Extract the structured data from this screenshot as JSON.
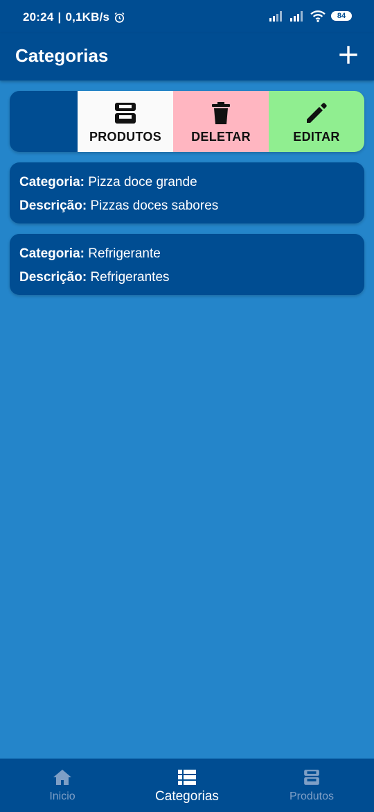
{
  "status": {
    "time": "20:24",
    "network_speed": "0,1KB/s",
    "battery": "84"
  },
  "appbar": {
    "title": "Categorias",
    "add_icon": "plus-icon"
  },
  "swipe_actions": [
    {
      "label": "PRODUTOS",
      "icon": "inbox-tray-icon",
      "color": "#fafafa"
    },
    {
      "label": "DELETAR",
      "icon": "trash-icon",
      "color": "#ffb6c1"
    },
    {
      "label": "EDITAR",
      "icon": "pencil-icon",
      "color": "#90ee90"
    }
  ],
  "items": [
    {
      "category_label": "Categoria:",
      "category": "Pizza doce grande",
      "description_label": "Descrição:",
      "description": "Pizzas doces sabores"
    },
    {
      "category_label": "Categoria:",
      "category": "Refrigerante",
      "description_label": "Descrição:",
      "description": "Refrigerantes"
    }
  ],
  "bottom_nav": [
    {
      "label": "Inicio",
      "icon": "home-icon",
      "active": false
    },
    {
      "label": "Categorias",
      "icon": "list-icon",
      "active": true
    },
    {
      "label": "Produtos",
      "icon": "inbox-tray-icon",
      "active": false
    }
  ],
  "colors": {
    "primary": "#004d92",
    "background": "#2485ca",
    "inactive_tab": "#7e9fc6"
  }
}
